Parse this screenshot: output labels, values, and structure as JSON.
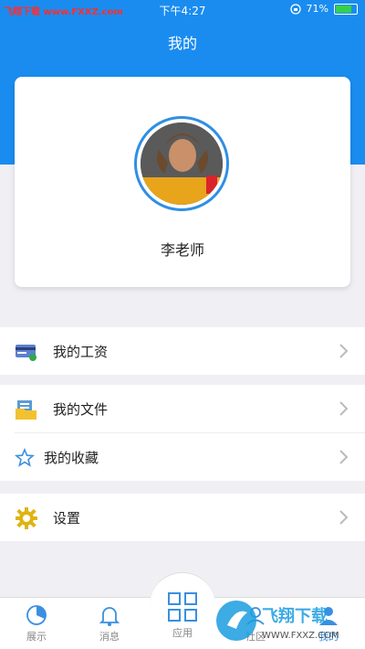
{
  "status_bar": {
    "watermark": "飞翔下载 www.FXXZ.com",
    "time": "下午4:27",
    "battery": "71%"
  },
  "header": {
    "title": "我的"
  },
  "profile": {
    "name": "李老师"
  },
  "menu": [
    {
      "label": "我的工资"
    },
    {
      "label": "我的文件"
    },
    {
      "label": "我的收藏"
    },
    {
      "label": "设置"
    }
  ],
  "tabbar": {
    "items": [
      "展示",
      "消息",
      "应用",
      "社区",
      "我的"
    ]
  },
  "watermark": {
    "brand": "飞翔下载",
    "url": "WWW.FXXZ.COM"
  },
  "colors": {
    "primary": "#1a8cf0",
    "background": "#efeff4"
  }
}
